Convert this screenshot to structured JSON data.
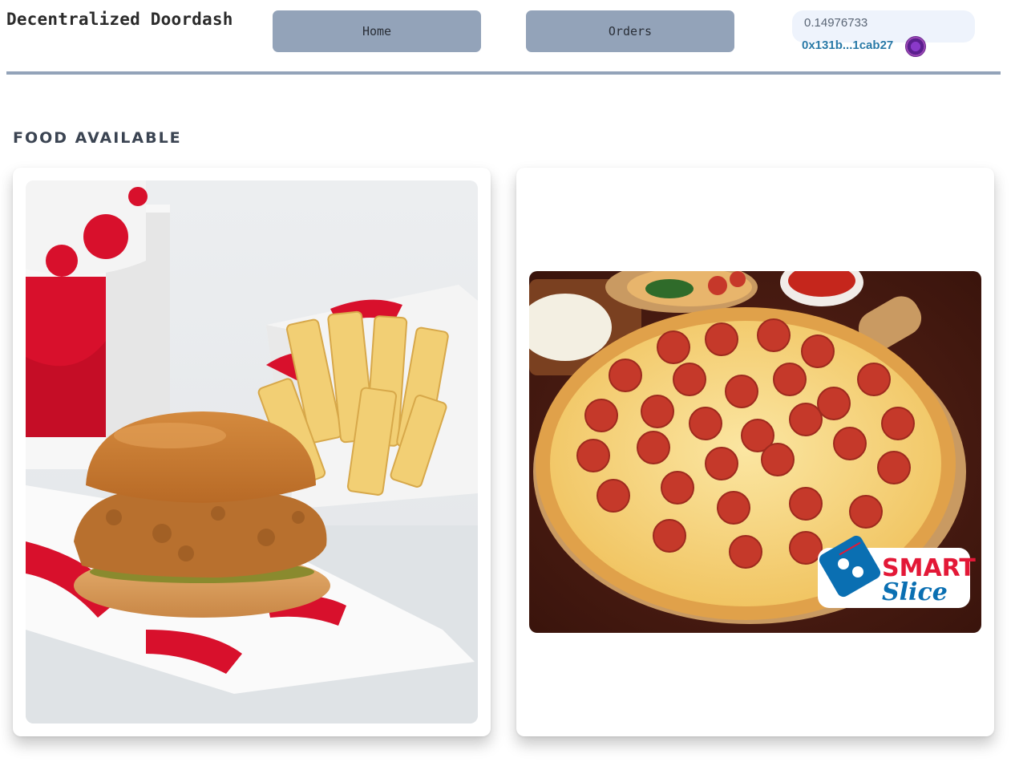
{
  "header": {
    "app_title": "Decentralized Doordash",
    "nav": {
      "home_label": "Home",
      "orders_label": "Orders"
    },
    "wallet": {
      "balance": "0.14976733",
      "address": "0x131b...1cab27"
    }
  },
  "main": {
    "section_title": "FOOD AVAILABLE",
    "items": [
      {
        "image_icon": "chicken-sandwich-fries-photo"
      },
      {
        "image_icon": "pepperoni-pizza-photo",
        "logo_text_1": "SMART",
        "logo_text_2": "Slice"
      }
    ]
  },
  "colors": {
    "nav_button_bg": "#93a3b9",
    "divider": "#93a3b9",
    "address": "#2a7aa8",
    "wallet_bg": "#eef3fc"
  }
}
